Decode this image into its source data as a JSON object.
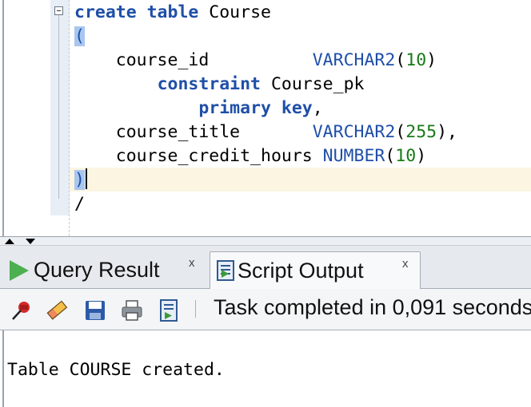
{
  "editor": {
    "lines": {
      "l1": {
        "kw": "create table",
        "name": " Course"
      },
      "l2": {
        "paren": "("
      },
      "l3": {
        "indent": "    ",
        "col": "course_id          ",
        "type": "VARCHAR2",
        "open": "(",
        "num": "10",
        "close": ")"
      },
      "l4": {
        "indent": "        ",
        "kw": "constraint",
        "name": " Course_pk"
      },
      "l5": {
        "indent": "            ",
        "kw": "primary key",
        "tail": ","
      },
      "l6": {
        "indent": "    ",
        "col": "course_title       ",
        "type": "VARCHAR2",
        "open": "(",
        "num": "255",
        "close": "),"
      },
      "l7": {
        "indent": "    ",
        "col": "course_credit_hours ",
        "type": "NUMBER",
        "open": "(",
        "num": "10",
        "close": ")"
      },
      "l8": {
        "paren": ")"
      },
      "l9": {
        "text": "/"
      }
    }
  },
  "tabs": {
    "query_result": "Query Result",
    "script_output": "Script Output",
    "close_glyph": "x"
  },
  "toolbar": {
    "status": "Task completed in 0,091 seconds",
    "icons": [
      "pin-icon",
      "eraser-icon",
      "save-icon",
      "print-icon",
      "run-script-icon"
    ]
  },
  "output": {
    "text": "Table COURSE created."
  },
  "colors": {
    "keyword": "#1f4fa8",
    "number": "#187a18",
    "current_line": "#fbf5e1",
    "bracket_highlight": "#a9c7ee"
  }
}
